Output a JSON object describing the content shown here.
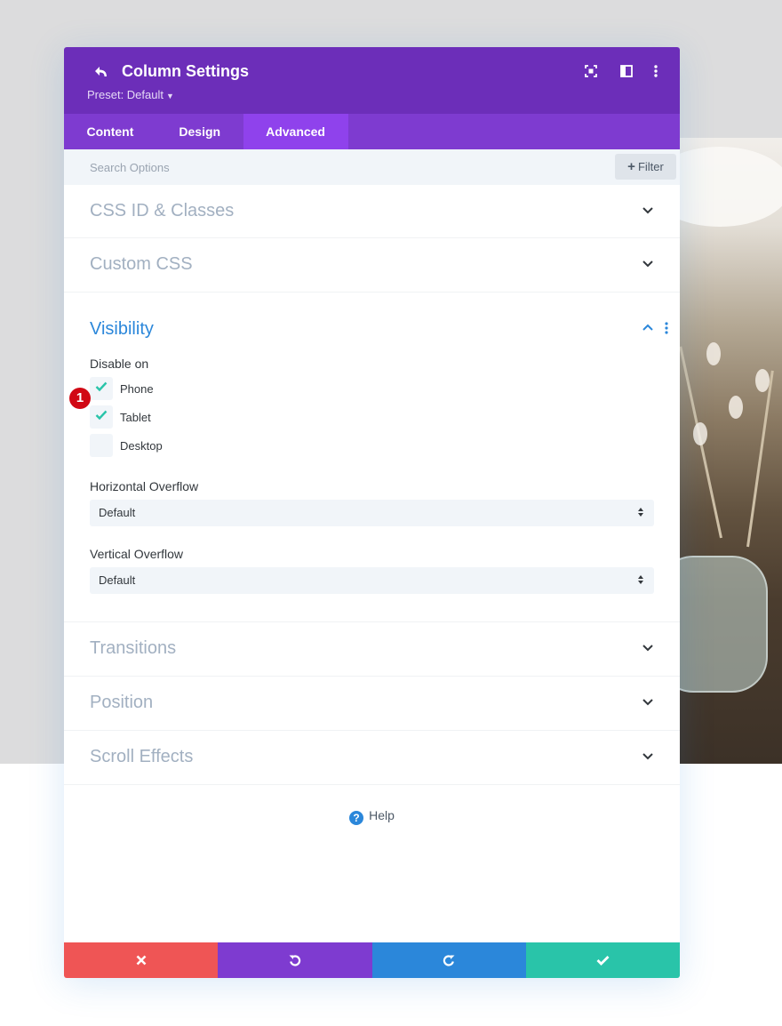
{
  "header": {
    "title": "Column Settings",
    "preset_label": "Preset: Default",
    "color": "#6c2eb9",
    "icons": [
      "undo-icon",
      "fullscreen-icon",
      "sidebar-layout-icon",
      "more-dots-icon"
    ]
  },
  "tabs": [
    {
      "label": "Content",
      "active": false
    },
    {
      "label": "Design",
      "active": false
    },
    {
      "label": "Advanced",
      "active": true
    }
  ],
  "search": {
    "placeholder": "Search Options",
    "value": "",
    "filter_label": "Filter"
  },
  "sections": {
    "css_id": "CSS ID & Classes",
    "custom_css": "Custom CSS",
    "visibility": {
      "title": "Visibility",
      "expanded": true,
      "disable_on_label": "Disable on",
      "options": [
        {
          "label": "Phone",
          "checked": true
        },
        {
          "label": "Tablet",
          "checked": true
        },
        {
          "label": "Desktop",
          "checked": false
        }
      ],
      "horizontal_overflow": {
        "label": "Horizontal Overflow",
        "value": "Default"
      },
      "vertical_overflow": {
        "label": "Vertical Overflow",
        "value": "Default"
      }
    },
    "transitions": "Transitions",
    "position": "Position",
    "scroll_effects": "Scroll Effects"
  },
  "annotation_badge": "1",
  "help_label": "Help",
  "footer": {
    "buttons": [
      {
        "name": "cancel",
        "color": "#ef5555"
      },
      {
        "name": "undo",
        "color": "#7e3bd0"
      },
      {
        "name": "redo",
        "color": "#2b87da"
      },
      {
        "name": "save",
        "color": "#29c4a9"
      }
    ]
  }
}
